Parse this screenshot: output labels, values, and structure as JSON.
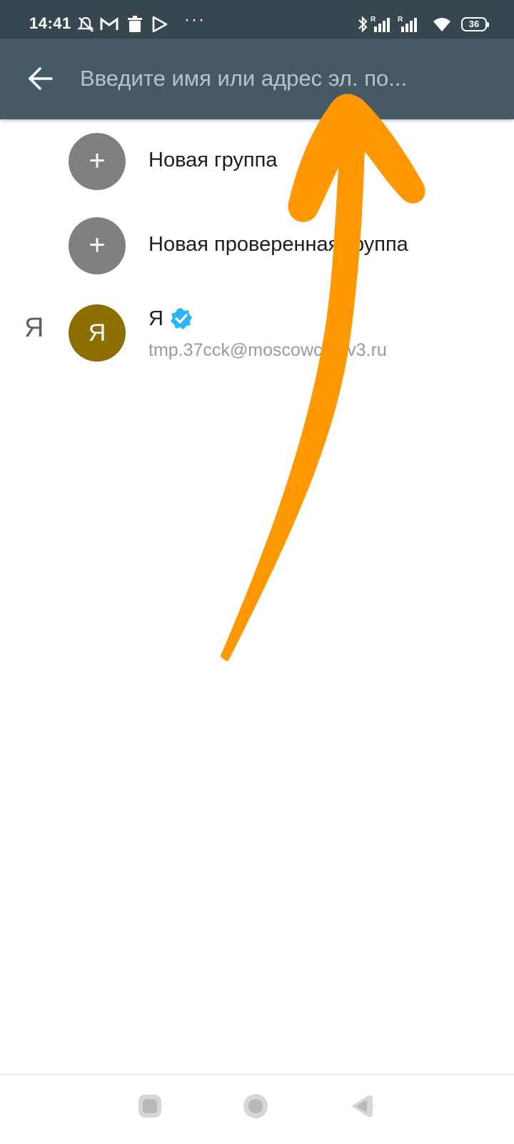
{
  "status_bar": {
    "time": "14:41",
    "battery": "36",
    "icons": [
      "mute-icon",
      "gmail-icon",
      "trash-icon",
      "play-store-icon",
      "more-icon",
      "bluetooth-icon",
      "signal-r-icon",
      "signal-r-icon",
      "wifi-icon",
      "battery-icon"
    ]
  },
  "toolbar": {
    "back_icon": "arrow-back-icon",
    "search_placeholder": "Введите имя или адрес эл. по..."
  },
  "list": {
    "new_group": {
      "icon": "+",
      "label": "Новая группа"
    },
    "new_verified_group": {
      "icon": "+",
      "label": "Новая проверенная группа"
    },
    "contact": {
      "index_letter": "Я",
      "avatar_letter": "Я",
      "avatar_color": "#8d6e00",
      "name": "Я",
      "badge_icon": "verified-check-icon",
      "email": "tmp.37cck@moscowchatv3.ru"
    }
  },
  "annotation": {
    "color": "#ff9800",
    "shape": "arrow-up-pointer"
  },
  "nav_bar": {
    "buttons": [
      "recents-button",
      "home-button",
      "back-button"
    ]
  }
}
